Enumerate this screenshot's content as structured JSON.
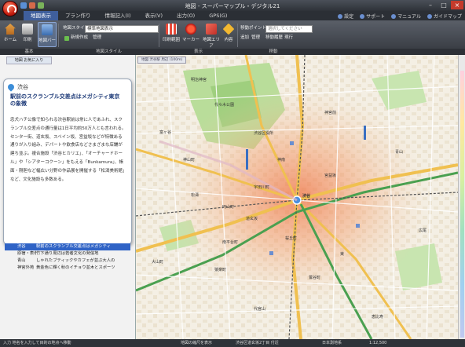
{
  "window": {
    "title": "地図 - スーパーマップル・デジタル21"
  },
  "menu": {
    "tabs": [
      "地図表示",
      "プラン作り",
      "情報記入(I)",
      "表示(V)",
      "出力(O)",
      "GPS(G)"
    ]
  },
  "help": {
    "settings": "設定",
    "support": "サポート",
    "manual": "マニュアル",
    "guide": "ガイドマップ"
  },
  "ribbon": {
    "home": "ホーム",
    "print": "印刷",
    "tool_bar": "地図バー",
    "map_style_label": "地図スタイル",
    "map_style_value": "標準地図表示",
    "new_create": "新規作成",
    "manage": "管理",
    "extra_range": "印刷範囲",
    "marker": "マーカー",
    "area_area": "地図エリア",
    "content": "内容",
    "move_point_label": "移動ポイント",
    "move_point_placeholder": "選択してください",
    "add": "追加",
    "manage2": "管理",
    "history": "移動履歴",
    "history2": "現行",
    "groups": [
      "基本",
      "地図スタイル",
      "表示",
      "移動"
    ]
  },
  "panel": {
    "tab": "地図 お気に入り",
    "place": "渋谷",
    "headline": "駅前のスクランブル交差点はメガシティ東京の象徴",
    "body": "忠犬ハチ公像で知られる渋谷駅前は常に人であふれ、スクランブル交差点の通行量は1日平均約50万人とも言われる。センター街、道玄坂、スペイン坂、宮益坂などが特徴ある通りが入り組み、デパートや飲食店などさまざまな店舗が建ち並ぶ。複合施設「渋谷ヒカリエ」、「オーチャードホール」や「シアターコクーン」をもえる「Bunkamura」、帳面・剛胆など幅広い分野の作品展を開催する「松濤美術館」など、文化施設も多数ある。",
    "results": [
      {
        "name": "渋谷",
        "desc": "駅前のスクランブル交差点はメガシティ",
        "selected": true
      },
      {
        "name": "原宿・表参道",
        "desc": "竹下通り周辺は若者文化の発信地",
        "selected": false
      },
      {
        "name": "青山",
        "desc": "しゃれたブティックやカフェが並ぶ大人の",
        "selected": false
      },
      {
        "name": "神宮外苑",
        "desc": "黄金色に輝く秋のイチョウ並木とスポーツ",
        "selected": false
      }
    ]
  },
  "map": {
    "tab": "地図 渋谷駅 周辺 (100m)",
    "labels": [
      "代々木公園",
      "明治神宮",
      "渋谷区役所",
      "渋谷",
      "恵比寿",
      "代官山",
      "道玄坂",
      "宮益坂",
      "青山",
      "神宮前",
      "松濤",
      "神山町",
      "宇田川町",
      "桜丘町",
      "東",
      "広尾",
      "神南",
      "富ヶ谷",
      "猿楽町",
      "南平台町",
      "大山町",
      "鶯谷町",
      "円山町"
    ]
  },
  "status": {
    "left": "入力 地名を入力して目的の地点へ移動",
    "mid": "地図の縮尺を表示",
    "center": "渋谷区道玄坂2丁目 付近",
    "coords": "日本測地系",
    "zoom": "1:12,500"
  }
}
